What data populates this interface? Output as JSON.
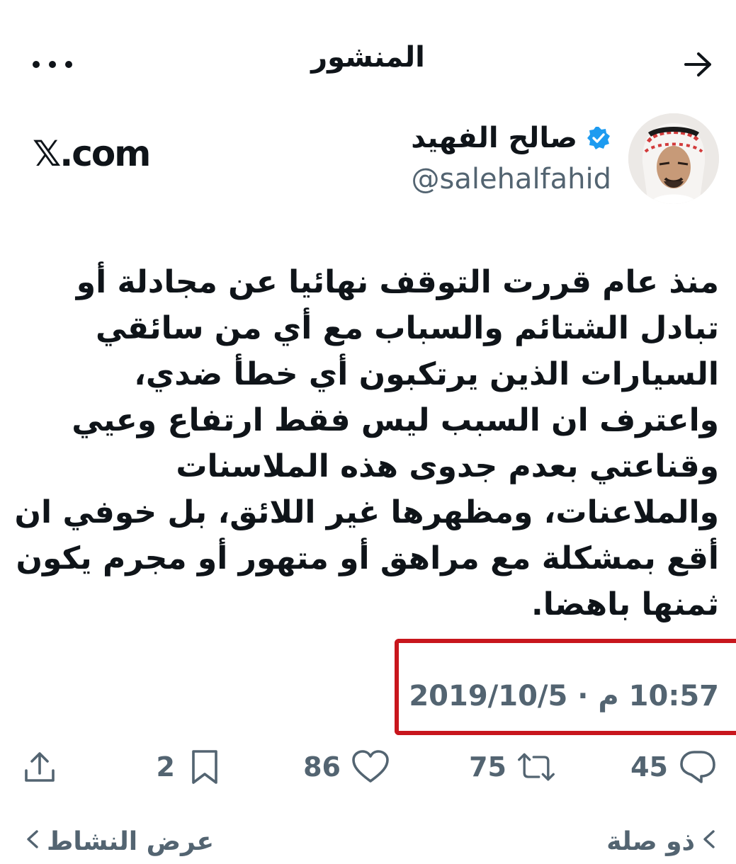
{
  "header": {
    "title": "المنشور"
  },
  "author": {
    "display_name": "صالح الفهيد",
    "handle": "@salehalfahid",
    "verified": true,
    "source_logo": "𝕏.com"
  },
  "tweet": {
    "lines": [
      "منذ عام قررت التوقف نهائيا عن مجادلة أو",
      "تبادل الشتائم والسباب مع أي من سائقي",
      "السيارات الذين يرتكبون أي خطأ ضدي،",
      "واعترف ان السبب ليس فقط ارتفاع وعيي",
      "وقناعتي بعدم جدوى هذه الملاسنات",
      "والملاعنات، ومظهرها غير اللائق، بل خوفي ان",
      "أقع بمشكلة مع مراهق أو متهور أو مجرم يكون",
      "ثمنها باهضا."
    ],
    "timestamp": "10:57 م · 2019/10/5"
  },
  "actions": {
    "replies": "45",
    "retweets": "75",
    "likes": "86",
    "bookmarks": "2"
  },
  "bottom": {
    "related": "ذو صلة",
    "view_activity": "عرض النشاط"
  },
  "colors": {
    "text": "#0f1419",
    "secondary": "#536471",
    "verified": "#1d9bf0",
    "highlight": "#c8161d"
  },
  "icons": {
    "back": "arrow-right-icon",
    "more": "ellipsis-icon",
    "verified": "verified-badge-icon",
    "reply": "reply-icon",
    "retweet": "retweet-icon",
    "like": "heart-icon",
    "bookmark": "bookmark-icon",
    "share": "share-icon"
  }
}
